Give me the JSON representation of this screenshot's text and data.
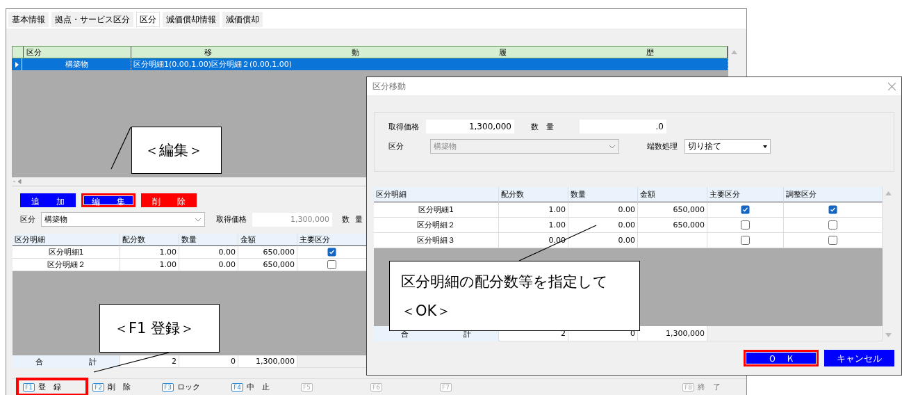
{
  "main_window": {
    "tabs": [
      {
        "label": "基本情報",
        "selected": false
      },
      {
        "label": "拠点・サービス区分",
        "selected": false
      },
      {
        "label": "区分",
        "selected": true
      },
      {
        "label": "減価償却情報",
        "selected": false
      },
      {
        "label": "減価償却",
        "selected": false
      }
    ],
    "history_grid": {
      "category_heading": "区分",
      "history_heading": [
        "移",
        "動",
        "履",
        "歴"
      ],
      "rows": [
        {
          "category": "構築物",
          "history": "区分明細1(0.00,1.00)区分明細２(0.00,1.00)",
          "selected": true
        }
      ]
    },
    "buttons": [
      {
        "label": "追　　加",
        "kind": "add",
        "highlighted": false
      },
      {
        "label": "編　　集",
        "kind": "edit",
        "highlighted": true
      },
      {
        "label": "削　　除",
        "kind": "delete",
        "highlighted": false
      }
    ],
    "form": {
      "category_label": "区分",
      "category_value": "構築物",
      "price_label": "取得価格",
      "price_value": "1,300,000",
      "qty_label": [
        "数",
        "量"
      ]
    },
    "detail_table": {
      "columns": [
        "区分明細",
        "配分数",
        "数量",
        "金額",
        "主要区分"
      ],
      "rows": [
        {
          "name": "区分明細1",
          "ratio": "1.00",
          "quantity": "0.00",
          "amount": "650,000",
          "main": true
        },
        {
          "name": "区分明細２",
          "ratio": "1.00",
          "quantity": "0.00",
          "amount": "650,000",
          "main": false
        }
      ],
      "total": {
        "label": [
          "合",
          "計"
        ],
        "ratio": "2",
        "quantity": "0",
        "amount": "1,300,000"
      }
    },
    "function_keys": [
      {
        "key": "F1",
        "label": "登　録",
        "enabled": true,
        "highlighted": true
      },
      {
        "key": "F2",
        "label": "削　除",
        "enabled": true,
        "highlighted": false
      },
      {
        "key": "F3",
        "label": "ロック",
        "enabled": true,
        "highlighted": false
      },
      {
        "key": "F4",
        "label": "中　止",
        "enabled": true,
        "highlighted": false
      },
      {
        "key": "F5",
        "enabled": false,
        "highlighted": false
      },
      {
        "key": "F6",
        "enabled": false,
        "highlighted": false
      },
      {
        "key": "F7",
        "enabled": false,
        "highlighted": false
      },
      {
        "key": "F8",
        "label": "終　了",
        "enabled": false,
        "highlighted": false
      }
    ]
  },
  "dialog": {
    "title": "区分移動",
    "fields": {
      "price_label": "取得価格",
      "price_value": "1,300,000",
      "qty_label": "数　量",
      "qty_value": ".0",
      "category_label": "区分",
      "category_value": "構築物",
      "category_disabled": true,
      "rounding_label": "端数処理",
      "rounding_value": "切り捨て"
    },
    "table": {
      "columns": [
        "区分明細",
        "配分数",
        "数量",
        "金額",
        "主要区分",
        "調整区分"
      ],
      "rows": [
        {
          "name": "区分明細1",
          "ratio": "1.00",
          "quantity": "0.00",
          "amount": "650,000",
          "main": true,
          "adjust": true
        },
        {
          "name": "区分明細２",
          "ratio": "1.00",
          "quantity": "0.00",
          "amount": "650,000",
          "main": false,
          "adjust": false
        },
        {
          "name": "区分明細３",
          "ratio": "0.00",
          "quantity": "0.00",
          "main": false,
          "adjust": false
        }
      ],
      "total": {
        "label": [
          "合",
          "計"
        ],
        "ratio": "2",
        "quantity": "0",
        "amount": "1,300,000"
      }
    },
    "buttons": [
      {
        "label": "Ｏ　Ｋ",
        "highlighted": true
      },
      {
        "label": "キャンセル",
        "highlighted": false
      }
    ]
  },
  "callouts": [
    {
      "lines": [
        "＜編集＞"
      ]
    },
    {
      "lines": [
        "＜F1 登録＞"
      ]
    },
    {
      "lines": [
        "区分明細の配分数等を指定して",
        "＜OK＞"
      ]
    }
  ]
}
